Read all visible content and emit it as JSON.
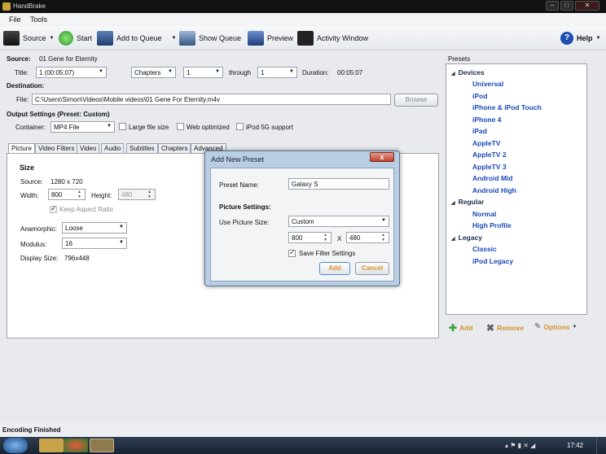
{
  "window": {
    "title": "HandBrake"
  },
  "menu": [
    "File",
    "Tools"
  ],
  "toolbar": {
    "source": "Source",
    "start": "Start",
    "add_to_queue": "Add to Queue",
    "show_queue": "Show Queue",
    "preview": "Preview",
    "activity": "Activity Window",
    "help": "Help"
  },
  "source": {
    "label": "Source:",
    "value": "01 Gene for Eternity",
    "title_label": "Title:",
    "title_value": "1 (00:05:07)",
    "mode_value": "Chapters",
    "from_value": "1",
    "through_label": "through",
    "to_value": "1",
    "duration_label": "Duration:",
    "duration_value": "00:05:07"
  },
  "destination": {
    "label": "Destination:",
    "file_label": "File:",
    "file_value": "C:\\Users\\Simon\\Videos\\Mobile videos\\01 Gene For Eternity.m4v",
    "browse": "Browse"
  },
  "output": {
    "label": "Output Settings (Preset: Custom)",
    "container_label": "Container:",
    "container_value": "MP4 File",
    "large_file": "Large file size",
    "web_optimized": "Web optimized",
    "ipod_5g": "iPod 5G support"
  },
  "tabs": [
    "Picture",
    "Video Filters",
    "Video",
    "Audio",
    "Subtitles",
    "Chapters",
    "Advanced"
  ],
  "picture": {
    "size_heading": "Size",
    "source_label": "Source:",
    "source_value": "1280 x 720",
    "width_label": "Width:",
    "width_value": "800",
    "height_label": "Height:",
    "height_value": "480",
    "keep_aspect": "Keep Aspect Ratio",
    "anamorphic_label": "Anamorphic:",
    "anamorphic_value": "Loose",
    "modulus_label": "Modulus:",
    "modulus_value": "16",
    "display_label": "Display Size:",
    "display_value": "796x448"
  },
  "presets": {
    "heading": "Presets",
    "groups": [
      {
        "name": "Devices",
        "items": [
          "Universal",
          "iPod",
          "iPhone & iPod Touch",
          "iPhone 4",
          "iPad",
          "AppleTV",
          "AppleTV 2",
          "AppleTV 3",
          "Android Mid",
          "Android High"
        ]
      },
      {
        "name": "Regular",
        "items": [
          "Normal",
          "High Profile"
        ]
      },
      {
        "name": "Legacy",
        "items": [
          "Classic",
          "iPod Legacy"
        ]
      }
    ],
    "add": "Add",
    "remove": "Remove",
    "options": "Options"
  },
  "dialog": {
    "title": "Add New Preset",
    "close": "x",
    "name_label": "Preset Name:",
    "name_value": "Galaxy S",
    "picture_settings": "Picture Settings:",
    "use_size_label": "Use Picture Size:",
    "use_size_value": "Custom",
    "width_value": "800",
    "x_label": "X",
    "height_value": "480",
    "save_filter": "Save Filter Settings",
    "add": "Add",
    "cancel": "Cancel"
  },
  "status": "Encoding Finished",
  "clock": "17:42",
  "colors": {
    "accent": "#1a48b8",
    "taskbar": "#1f2b3b"
  }
}
